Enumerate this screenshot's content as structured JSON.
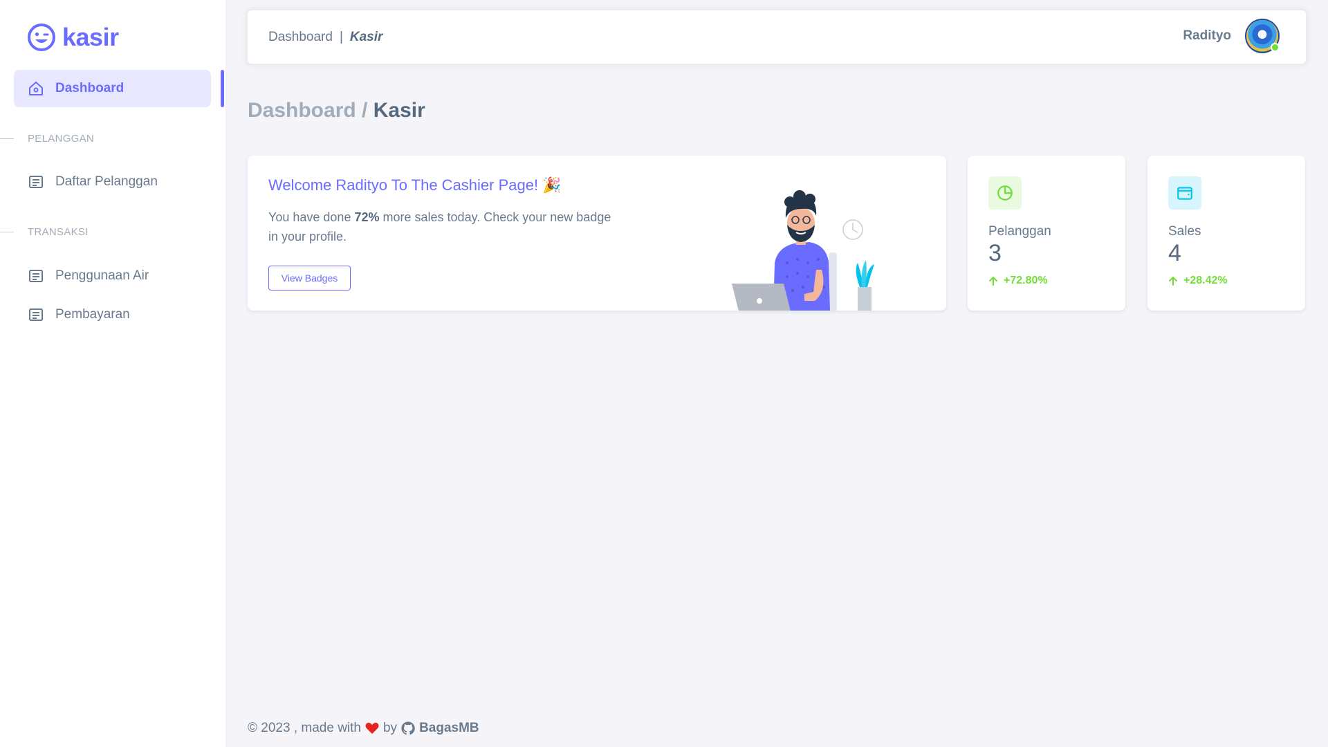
{
  "brand": {
    "name": "kasir"
  },
  "sidebar": {
    "items": [
      {
        "label": "Dashboard",
        "active": true,
        "icon": "home-icon"
      },
      {
        "label": "Daftar Pelanggan",
        "icon": "list-icon"
      },
      {
        "label": "Penggunaan Air",
        "icon": "list-icon"
      },
      {
        "label": "Pembayaran",
        "icon": "list-icon"
      }
    ],
    "headers": [
      "PELANGGAN",
      "TRANSAKSI"
    ]
  },
  "navbar": {
    "crumb": "Dashboard",
    "separator": "|",
    "current": "Kasir",
    "user_name": "Radityo"
  },
  "page": {
    "title_prefix": "Dashboard /",
    "title_current": "Kasir"
  },
  "welcome": {
    "title": "Welcome Radityo To The Cashier Page! 🎉",
    "text_before": "You have done",
    "percent": "72%",
    "text_after": "more sales today. Check your new badge in your profile.",
    "button": "View Badges"
  },
  "stats": [
    {
      "label": "Pelanggan",
      "value": "3",
      "change": "+72.80%",
      "icon": "chart-pie-icon",
      "icon_color": "#71dd37",
      "icon_bg": "#e8fadf"
    },
    {
      "label": "Sales",
      "value": "4",
      "change": "+28.42%",
      "icon": "wallet-icon",
      "icon_color": "#03c3ec",
      "icon_bg": "#d7f5fc"
    }
  ],
  "footer": {
    "prefix": "© 2023 , made with",
    "by": "by",
    "author": "BagasMB"
  },
  "colors": {
    "primary": "#696cff",
    "success": "#71dd37",
    "info": "#03c3ec"
  }
}
